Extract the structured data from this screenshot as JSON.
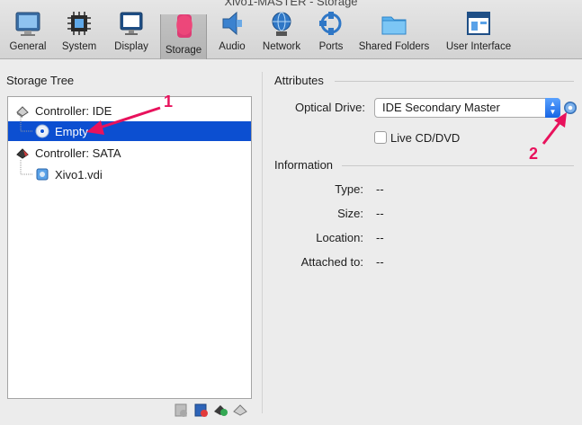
{
  "window": {
    "title": "Xivo1-MASTER - Storage"
  },
  "toolbar": {
    "items": [
      {
        "label": "General"
      },
      {
        "label": "System"
      },
      {
        "label": "Display"
      },
      {
        "label": "Storage",
        "active": true
      },
      {
        "label": "Audio"
      },
      {
        "label": "Network"
      },
      {
        "label": "Ports"
      },
      {
        "label": "Shared Folders"
      },
      {
        "label": "User Interface"
      }
    ]
  },
  "storage_tree": {
    "title": "Storage Tree",
    "items": [
      {
        "label": "Controller: IDE",
        "icon": "ide-controller-icon"
      },
      {
        "label": "Empty",
        "icon": "cd-disc-icon",
        "selected": true
      },
      {
        "label": "Controller: SATA",
        "icon": "sata-controller-icon"
      },
      {
        "label": "Xivo1.vdi",
        "icon": "hard-disk-icon"
      }
    ]
  },
  "attributes": {
    "title": "Attributes",
    "optical_drive_label": "Optical Drive:",
    "optical_drive_value": "IDE Secondary Master",
    "live_cd_label": "Live CD/DVD"
  },
  "information": {
    "title": "Information",
    "rows": [
      {
        "label": "Type:",
        "value": "--"
      },
      {
        "label": "Size:",
        "value": "--"
      },
      {
        "label": "Location:",
        "value": "--"
      },
      {
        "label": "Attached to:",
        "value": "--"
      }
    ]
  },
  "annotations": {
    "callout_1": "1",
    "callout_2": "2"
  },
  "colors": {
    "selection": "#0c4fd1",
    "callout": "#e8125c",
    "accent": "#1765e4"
  }
}
